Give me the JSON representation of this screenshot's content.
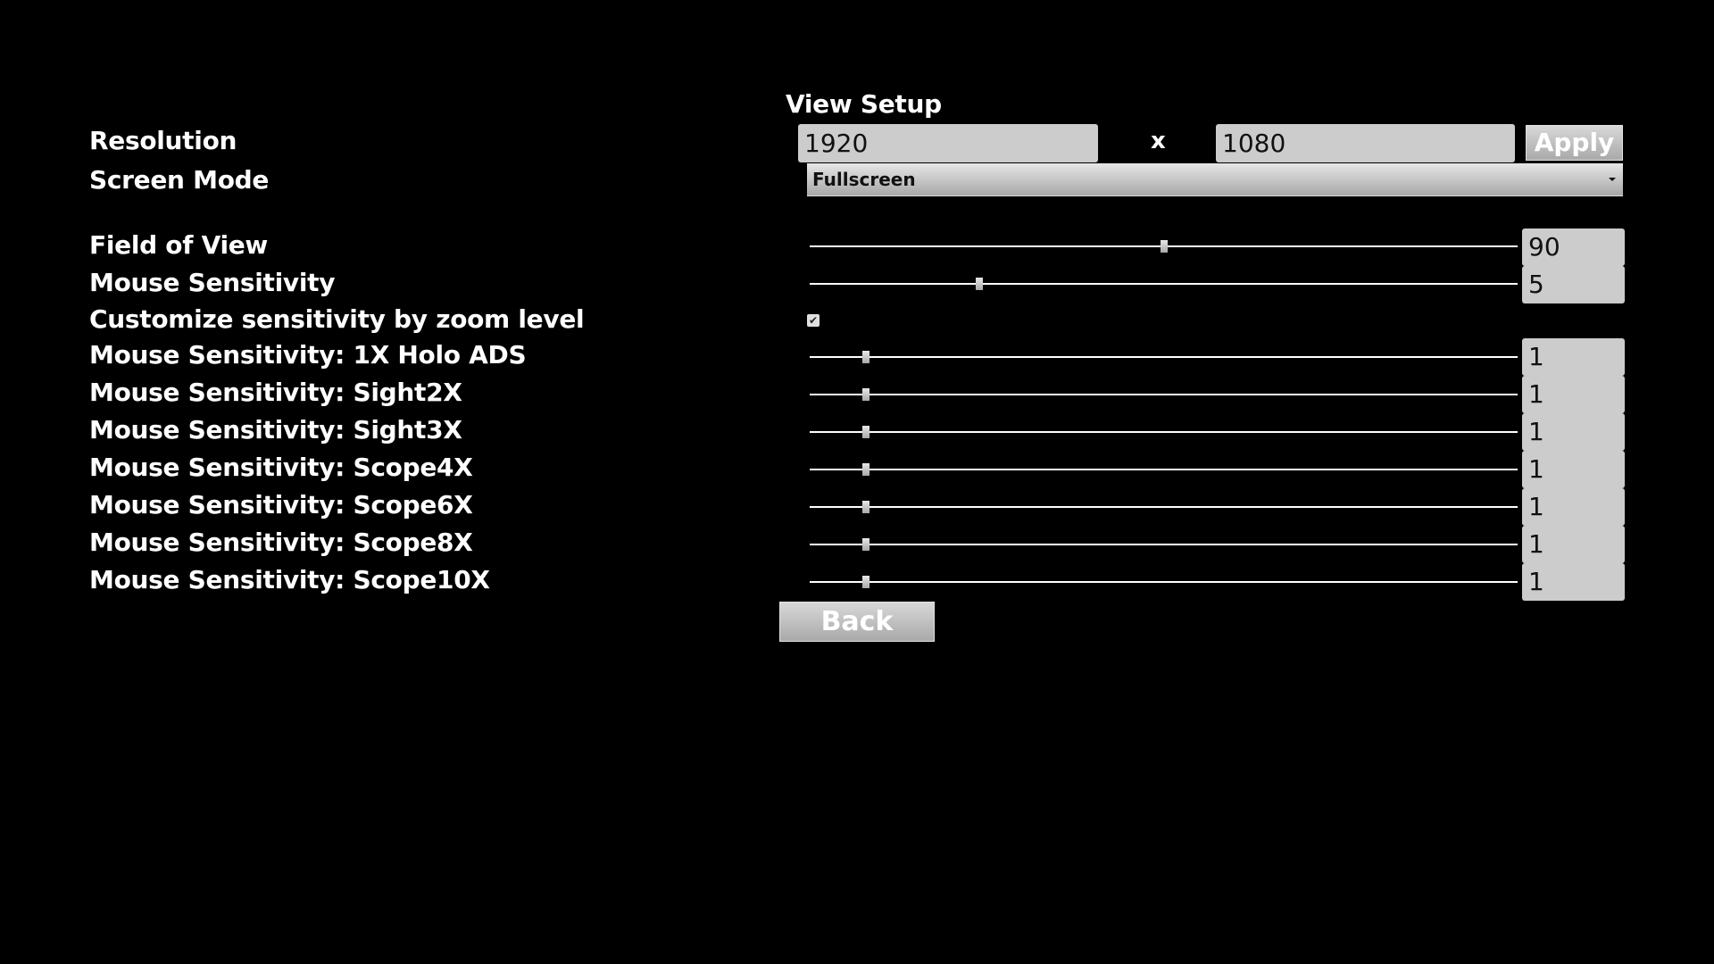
{
  "header": {
    "title": "View Setup"
  },
  "resolution": {
    "label": "Resolution",
    "width_value": "1920",
    "separator": "x",
    "height_value": "1080",
    "apply_label": "Apply"
  },
  "screen_mode": {
    "label": "Screen Mode",
    "selected": "Fullscreen"
  },
  "field_of_view": {
    "label": "Field of View",
    "value": "90",
    "slider_fraction": 0.5
  },
  "mouse_sensitivity": {
    "label": "Mouse Sensitivity",
    "value": "5",
    "slider_fraction": 0.24
  },
  "customize_by_zoom": {
    "label": "Customize sensitivity by zoom level",
    "checked": true,
    "check_glyph": "✔"
  },
  "zoom_sensitivities": [
    {
      "label": "Mouse Sensitivity: 1X Holo ADS",
      "value": "1",
      "slider_fraction": 0.08
    },
    {
      "label": "Mouse Sensitivity: Sight2X",
      "value": "1",
      "slider_fraction": 0.08
    },
    {
      "label": "Mouse Sensitivity: Sight3X",
      "value": "1",
      "slider_fraction": 0.08
    },
    {
      "label": "Mouse Sensitivity: Scope4X",
      "value": "1",
      "slider_fraction": 0.08
    },
    {
      "label": "Mouse Sensitivity: Scope6X",
      "value": "1",
      "slider_fraction": 0.08
    },
    {
      "label": "Mouse Sensitivity: Scope8X",
      "value": "1",
      "slider_fraction": 0.08
    },
    {
      "label": "Mouse Sensitivity: Scope10X",
      "value": "1",
      "slider_fraction": 0.08
    }
  ],
  "footer": {
    "back_label": "Back"
  }
}
